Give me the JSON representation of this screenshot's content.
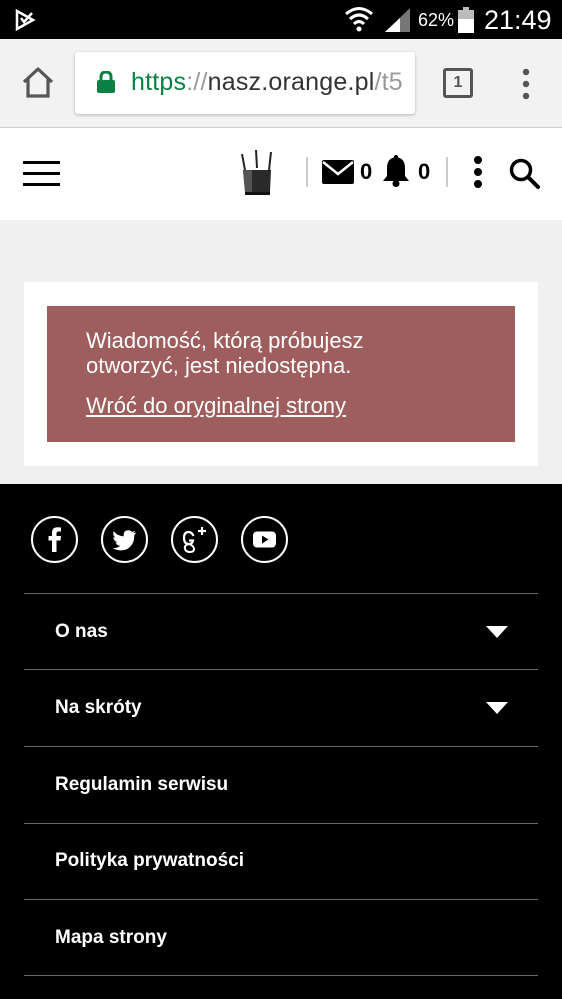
{
  "status_bar": {
    "battery_percent": "62%",
    "time": "21:49"
  },
  "browser": {
    "url_scheme": "https",
    "url_separator": "://",
    "url_host": "nasz.orange.pl",
    "url_path": "/t5",
    "tab_count": "1"
  },
  "header": {
    "mail_count": "0",
    "notification_count": "0"
  },
  "alert": {
    "message": "Wiadomość, którą próbujesz otworzyć, jest niedostępna.",
    "link_label": "Wróć do oryginalnej strony"
  },
  "footer": {
    "social_icons": [
      "facebook-icon",
      "twitter-icon",
      "google-plus-icon",
      "youtube-icon"
    ],
    "items": [
      {
        "label": "O nas",
        "expandable": true
      },
      {
        "label": "Na skróty",
        "expandable": true
      },
      {
        "label": "Regulamin serwisu",
        "expandable": false
      },
      {
        "label": "Polityka prywatności",
        "expandable": false
      },
      {
        "label": "Mapa strony",
        "expandable": false
      }
    ]
  },
  "colors": {
    "alert_background": "#9e5e5e",
    "url_scheme_green": "#0b8043",
    "footer_background": "#000000"
  }
}
